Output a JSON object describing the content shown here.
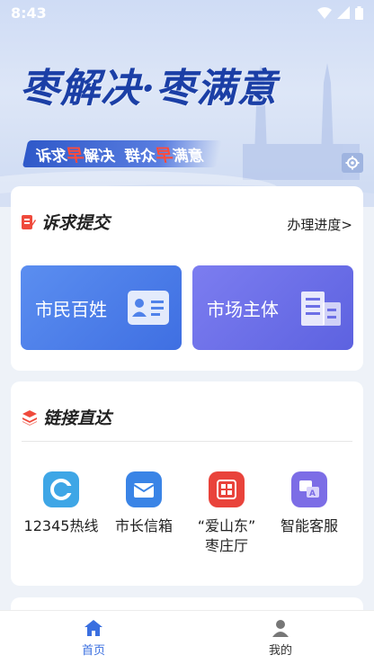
{
  "status_bar": {
    "time": "8:43"
  },
  "banner": {
    "title": "枣解决·枣满意",
    "slogan_parts": [
      "诉求",
      "早",
      "解决  群众",
      "早",
      "满意"
    ]
  },
  "petition": {
    "title": "诉求提交",
    "progress_link": "办理进度>",
    "tiles": [
      {
        "label": "市民百姓"
      },
      {
        "label": "市场主体"
      }
    ]
  },
  "links": {
    "title": "链接直达",
    "items": [
      {
        "line1": "12345热线",
        "line2": ""
      },
      {
        "line1": "市长信箱",
        "line2": ""
      },
      {
        "line1": "“爱山东”",
        "line2": "枣庄厅"
      },
      {
        "line1": "智能客服",
        "line2": ""
      }
    ]
  },
  "nav": {
    "items": [
      {
        "label": "首页",
        "active": true
      },
      {
        "label": "我的",
        "active": false
      }
    ]
  },
  "colors": {
    "primary": "#3a6fe0",
    "title_blue": "#1b3fa6",
    "accent_red": "#ff4b3a"
  }
}
